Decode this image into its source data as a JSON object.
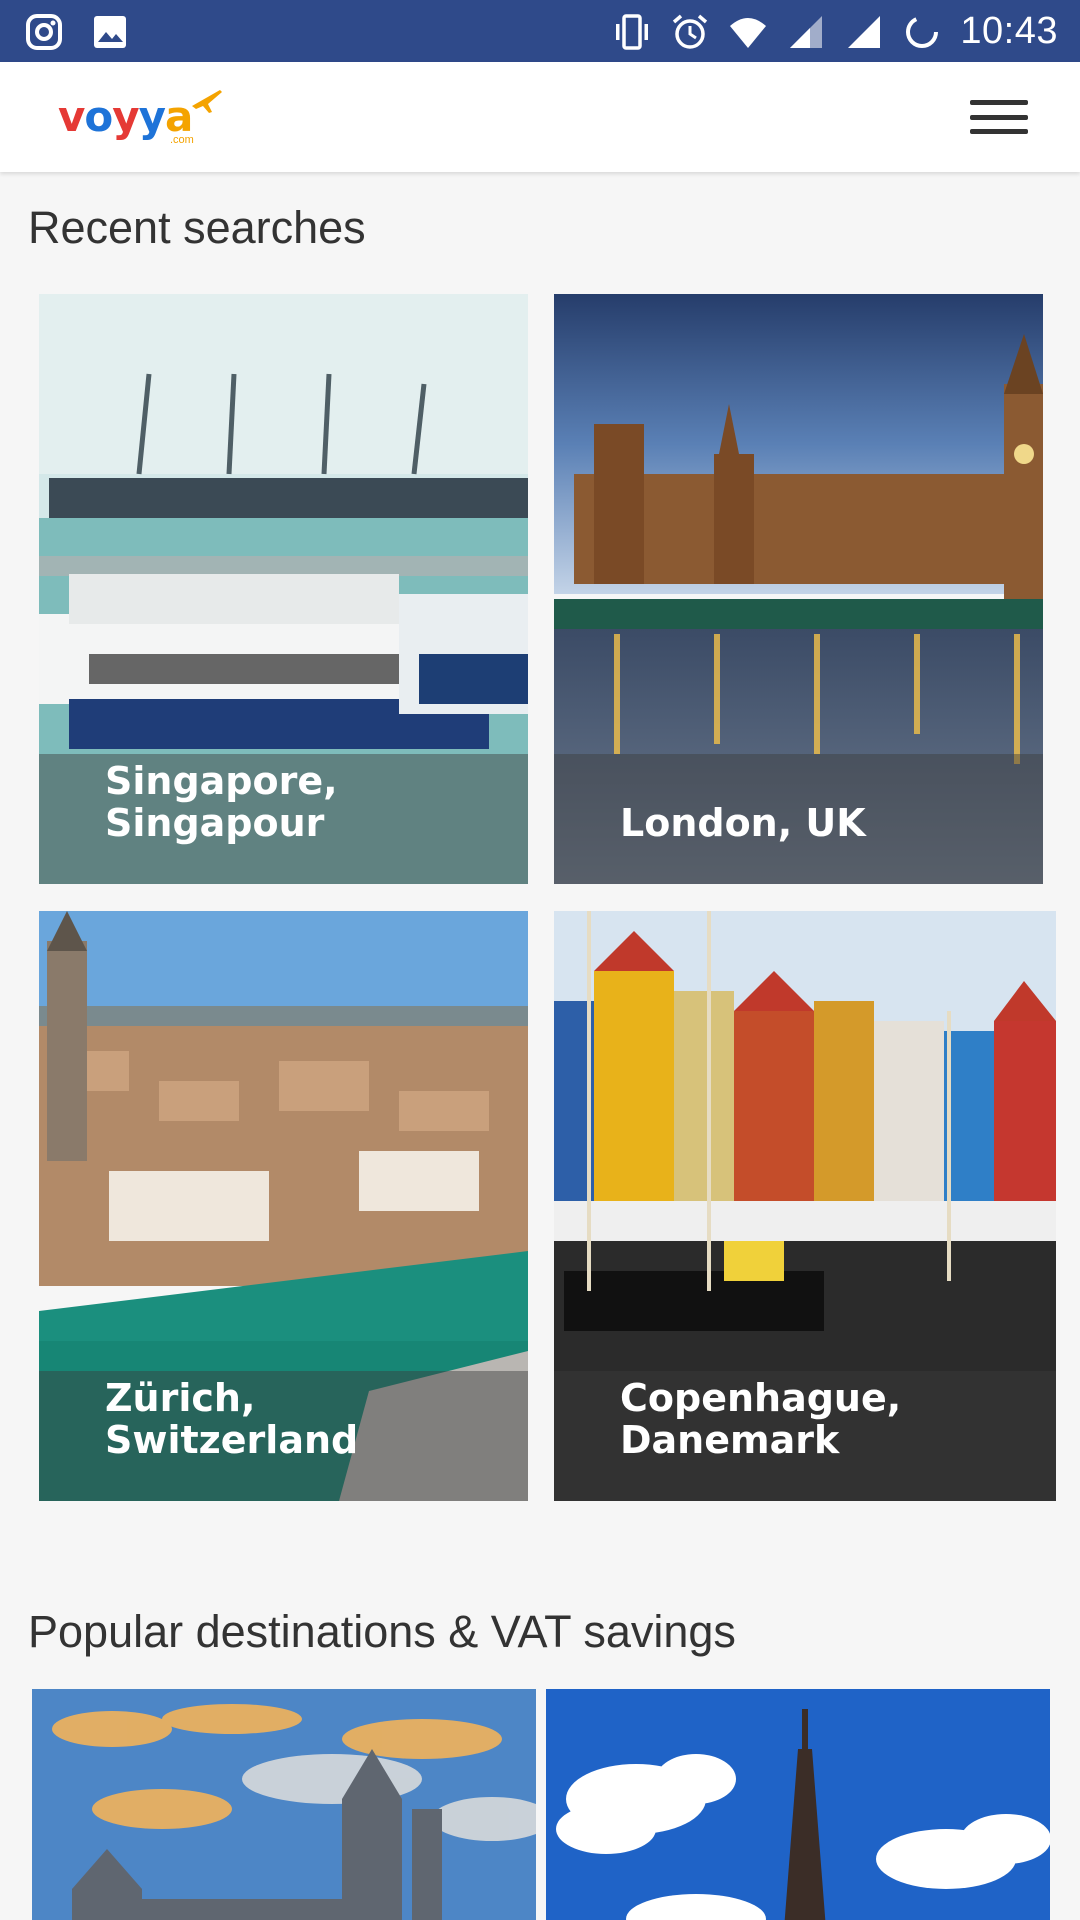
{
  "status_bar": {
    "time": "10:43",
    "icons": [
      "instagram-icon",
      "image-icon",
      "vibrate-icon",
      "alarm-icon",
      "wifi-icon",
      "signal-icon",
      "signal-full-icon",
      "battery-saver-icon"
    ]
  },
  "header": {
    "logo_text": "voyya",
    "logo_suffix": ".com",
    "menu_icon": "hamburger-menu-icon"
  },
  "recent_searches": {
    "title": "Recent searches",
    "items": [
      {
        "line1": "Singapore,",
        "line2": "Singapour"
      },
      {
        "line1": "London, UK",
        "line2": ""
      },
      {
        "line1": "Zürich,",
        "line2": "Switzerland"
      },
      {
        "line1": "Copenhague,",
        "line2": "Danemark"
      }
    ]
  },
  "popular": {
    "title": "Popular destinations & VAT savings"
  },
  "colors": {
    "status_bar": "#2f4a8a",
    "logo_red": "#e53935",
    "logo_blue": "#1e73d8",
    "logo_orange": "#f4a300"
  }
}
